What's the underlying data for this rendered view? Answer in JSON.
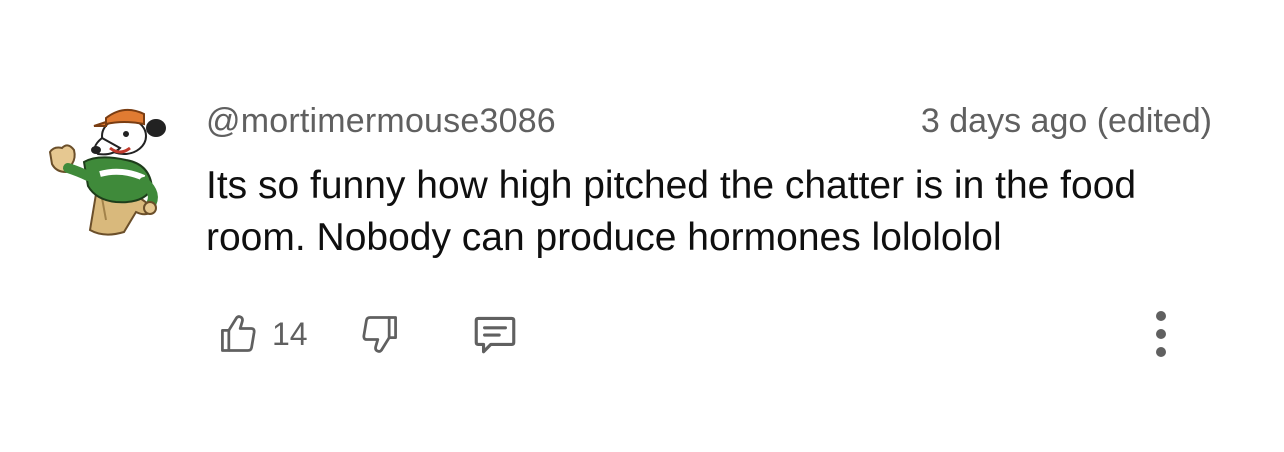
{
  "comment": {
    "author": "@mortimermouse3086",
    "timestamp": "3 days ago (edited)",
    "text": "Its so funny how high pitched the chatter is in the food room. Nobody can produce hormones lolololol",
    "avatar_icon": "cartoon-mouse-avatar"
  },
  "actions": {
    "like_icon": "thumbs-up-icon",
    "like_count": "14",
    "dislike_icon": "thumbs-down-icon",
    "reply_icon": "reply-comment-icon",
    "more_icon": "more-vertical-icon"
  },
  "colors": {
    "text_primary": "#0f0f0f",
    "text_secondary": "#606060",
    "icon": "#606060",
    "avatar_green": "#3f8a3a",
    "avatar_orange": "#e07b32",
    "avatar_tan": "#d9b97c"
  }
}
